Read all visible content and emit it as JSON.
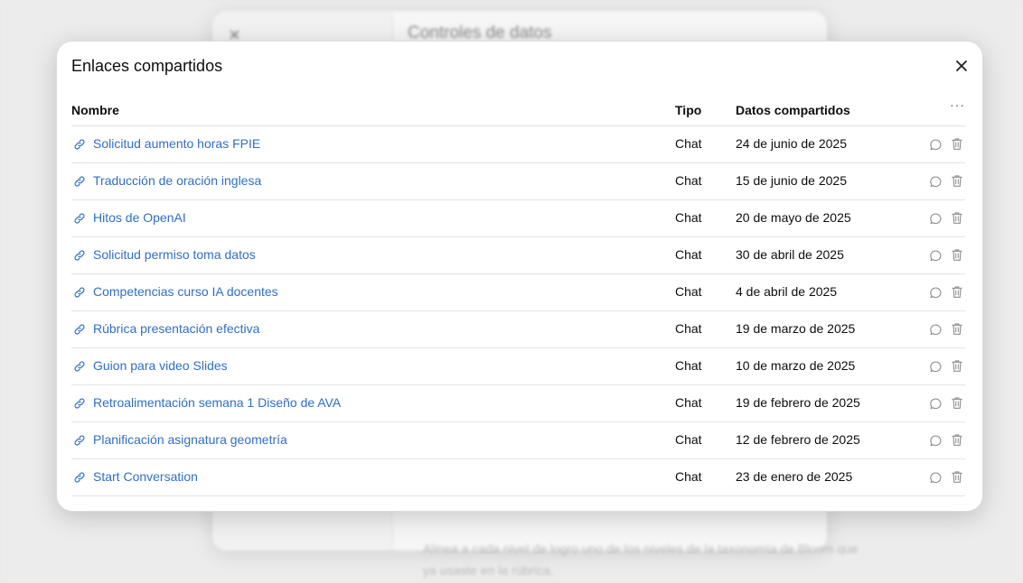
{
  "background": {
    "dialog_title": "Controles de datos",
    "bottom_text": "Alinea a cada nivel de logro uno de los niveles de la taxonomía de Bloom que ya usaste en la rúbrica."
  },
  "modal": {
    "title": "Enlaces compartidos",
    "columns": {
      "name": "Nombre",
      "type": "Tipo",
      "date": "Datos compartidos",
      "more": "···"
    },
    "rows": [
      {
        "name": "Solicitud aumento horas FPIE",
        "type": "Chat",
        "date": "24 de junio de 2025"
      },
      {
        "name": "Traducción de oración inglesa",
        "type": "Chat",
        "date": "15 de junio de 2025"
      },
      {
        "name": "Hitos de OpenAI",
        "type": "Chat",
        "date": "20 de mayo de 2025"
      },
      {
        "name": "Solicitud permiso toma datos",
        "type": "Chat",
        "date": "30 de abril de 2025"
      },
      {
        "name": "Competencias curso IA docentes",
        "type": "Chat",
        "date": "4 de abril de 2025"
      },
      {
        "name": "Rúbrica presentación efectiva",
        "type": "Chat",
        "date": "19 de marzo de 2025"
      },
      {
        "name": "Guion para video Slides",
        "type": "Chat",
        "date": "10 de marzo de 2025"
      },
      {
        "name": "Retroalimentación semana 1 Diseño de AVA",
        "type": "Chat",
        "date": "19 de febrero de 2025"
      },
      {
        "name": "Planificación asignatura geometría",
        "type": "Chat",
        "date": "12 de febrero de 2025"
      },
      {
        "name": "Start Conversation",
        "type": "Chat",
        "date": "23 de enero de 2025"
      }
    ]
  },
  "icons": {
    "close": "close-icon",
    "link": "link-icon",
    "chat": "chat-bubble-icon",
    "delete": "trash-icon"
  },
  "colors": {
    "link": "#2e6fc4",
    "icon": "#8e8e8e"
  }
}
